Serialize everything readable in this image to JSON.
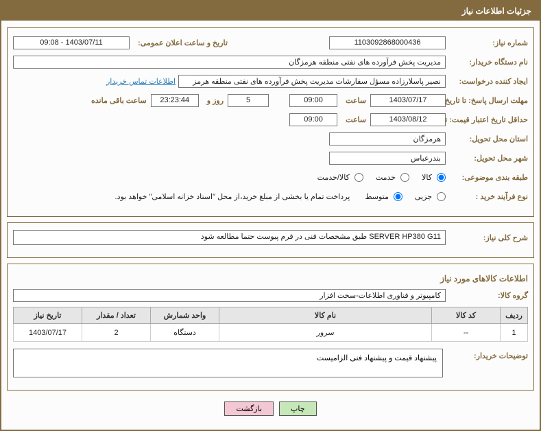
{
  "title": "جزئیات اطلاعات نیاز",
  "labels": {
    "need_no": "شماره نیاز:",
    "announce": "تاریخ و ساعت اعلان عمومی:",
    "buyer": "نام دستگاه خریدار:",
    "requester": "ایجاد کننده درخواست:",
    "contact_link": "اطلاعات تماس خریدار",
    "deadline": "مهلت ارسال پاسخ: تا تاریخ:",
    "time": "ساعت",
    "days_and": "روز و",
    "remaining": "ساعت باقی مانده",
    "min_valid": "حداقل تاریخ اعتبار قیمت: تا تاریخ:",
    "province": "استان محل تحویل:",
    "city": "شهر محل تحویل:",
    "category": "طبقه بندی موضوعی:",
    "cat_goods": "کالا",
    "cat_service": "خدمت",
    "cat_both": "کالا/خدمت",
    "process_type": "نوع فرآیند خرید :",
    "proc_partial": "جزیی",
    "proc_medium": "متوسط",
    "payment_note": "پرداخت تمام یا بخشی از مبلغ خرید،از محل \"اسناد خزانه اسلامی\" خواهد بود.",
    "desc": "شرح کلی نیاز:",
    "items_title": "اطلاعات کالاهای مورد نیاز",
    "item_group": "گروه کالا:",
    "buyer_notes": "توضیحات خریدار:",
    "btn_print": "چاپ",
    "btn_back": "بازگشت"
  },
  "values": {
    "need_no": "1103092868000436",
    "announce": "1403/07/11 - 09:08",
    "buyer": "مدیریت پخش فرآورده های نفتی منطقه هرمزگان",
    "requester": "نصیر پاسلارزاده مسؤل سفارشات مدیریت پخش فرآورده های نفتی منطقه هرمز",
    "deadline_date": "1403/07/17",
    "deadline_time": "09:00",
    "days": "5",
    "countdown": "23:23:44",
    "min_valid_date": "1403/08/12",
    "min_valid_time": "09:00",
    "province": "هرمزگان",
    "city": "بندرعباس",
    "desc": "SERVER HP380  G11 طبق مشخصات فنی در فرم پیوست حتما مطالعه شود",
    "item_group": "کامپیوتر و فناوری اطلاعات-سخت افزار",
    "buyer_notes": "پیشنهاد قیمت و پیشنهاد فنی الزامیست"
  },
  "table": {
    "headers": {
      "row": "ردیف",
      "code": "کد کالا",
      "name": "نام کالا",
      "unit": "واحد شمارش",
      "qty": "تعداد / مقدار",
      "date": "تاریخ نیاز"
    },
    "rows": [
      {
        "row": "1",
        "code": "--",
        "name": "سرور",
        "unit": "دستگاه",
        "qty": "2",
        "date": "1403/07/17"
      }
    ]
  }
}
